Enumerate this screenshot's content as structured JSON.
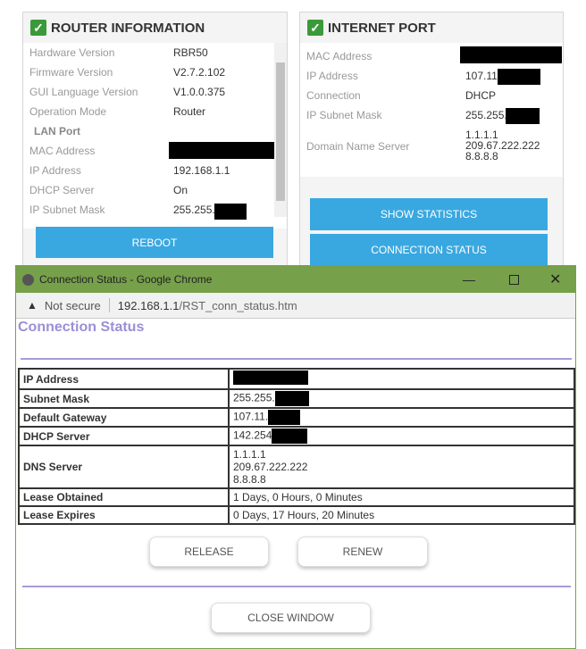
{
  "router": {
    "title": "ROUTER INFORMATION",
    "rows": [
      {
        "label": "Hardware Version",
        "value": "RBR50"
      },
      {
        "label": "Firmware Version",
        "value": "V2.7.2.102"
      },
      {
        "label": "GUI Language Version",
        "value": "V1.0.0.375"
      },
      {
        "label": "Operation Mode",
        "value": "Router"
      },
      {
        "label": "LAN Port",
        "value": ""
      },
      {
        "label": "MAC Address",
        "value": ""
      },
      {
        "label": "IP Address",
        "value": "192.168.1.1"
      },
      {
        "label": "DHCP Server",
        "value": "On"
      },
      {
        "label": "IP Subnet Mask",
        "value": "255.255."
      }
    ],
    "reboot": "REBOOT"
  },
  "internet": {
    "title": "INTERNET PORT",
    "rows": [
      {
        "label": "MAC Address",
        "value": ""
      },
      {
        "label": "IP Address",
        "value": "107.11"
      },
      {
        "label": "Connection",
        "value": "DHCP"
      },
      {
        "label": "IP Subnet Mask",
        "value": "255.255."
      },
      {
        "label": "Domain Name Server",
        "value": "1.1.1.1\n209.67.222.222\n8.8.8.8"
      }
    ],
    "show_stats": "SHOW STATISTICS",
    "conn_status": "CONNECTION STATUS"
  },
  "popup": {
    "window_title": "Connection Status - Google Chrome",
    "not_secure": "Not secure",
    "url_host": "192.168.1.1",
    "url_path": "/RST_conn_status.htm",
    "heading": "Connection Status",
    "rows": [
      {
        "label": "IP Address",
        "value": ""
      },
      {
        "label": "Subnet Mask",
        "value": "255.255."
      },
      {
        "label": "Default Gateway",
        "value": "107.11."
      },
      {
        "label": "DHCP Server",
        "value": "142.254"
      },
      {
        "label": "DNS Server",
        "value": "1.1.1.1\n209.67.222.222\n8.8.8.8"
      },
      {
        "label": "Lease Obtained",
        "value": "1 Days, 0 Hours, 0 Minutes"
      },
      {
        "label": "Lease Expires",
        "value": "0 Days, 17 Hours, 20 Minutes"
      }
    ],
    "release": "RELEASE",
    "renew": "RENEW",
    "close": "CLOSE WINDOW"
  }
}
